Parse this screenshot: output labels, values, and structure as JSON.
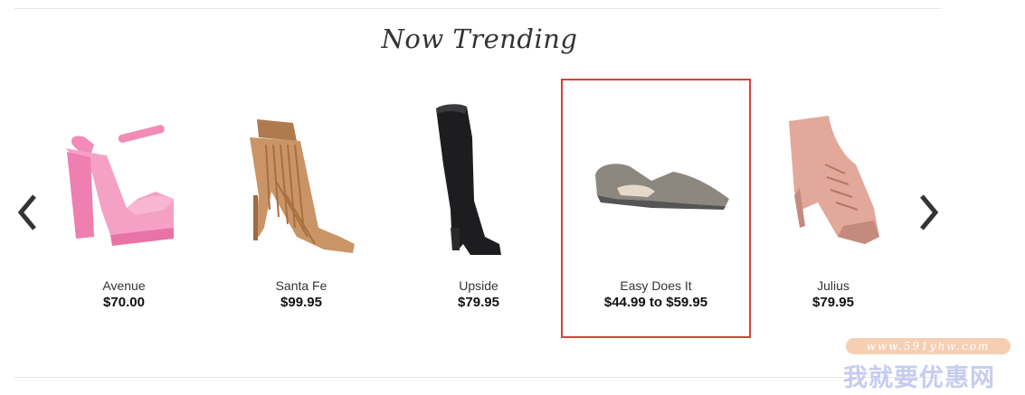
{
  "section": {
    "title": "Now Trending"
  },
  "carousel": {
    "prev_icon": "chevron-left-icon",
    "next_icon": "chevron-right-icon",
    "products": [
      {
        "name": "Avenue",
        "price": "$70.00",
        "color": "#f28bb8"
      },
      {
        "name": "Santa Fe",
        "price": "$99.95",
        "color": "#c99466"
      },
      {
        "name": "Upside",
        "price": "$79.95",
        "color": "#1d1d1f"
      },
      {
        "name": "Easy Does It",
        "price": "$44.99 to $59.95",
        "color": "#8c8880"
      },
      {
        "name": "Julius",
        "price": "$79.95",
        "color": "#e2a89a"
      }
    ]
  },
  "highlight_color": "#d9403a",
  "watermark": {
    "url": "www.591yhw.com",
    "text": "我就要优惠网"
  }
}
